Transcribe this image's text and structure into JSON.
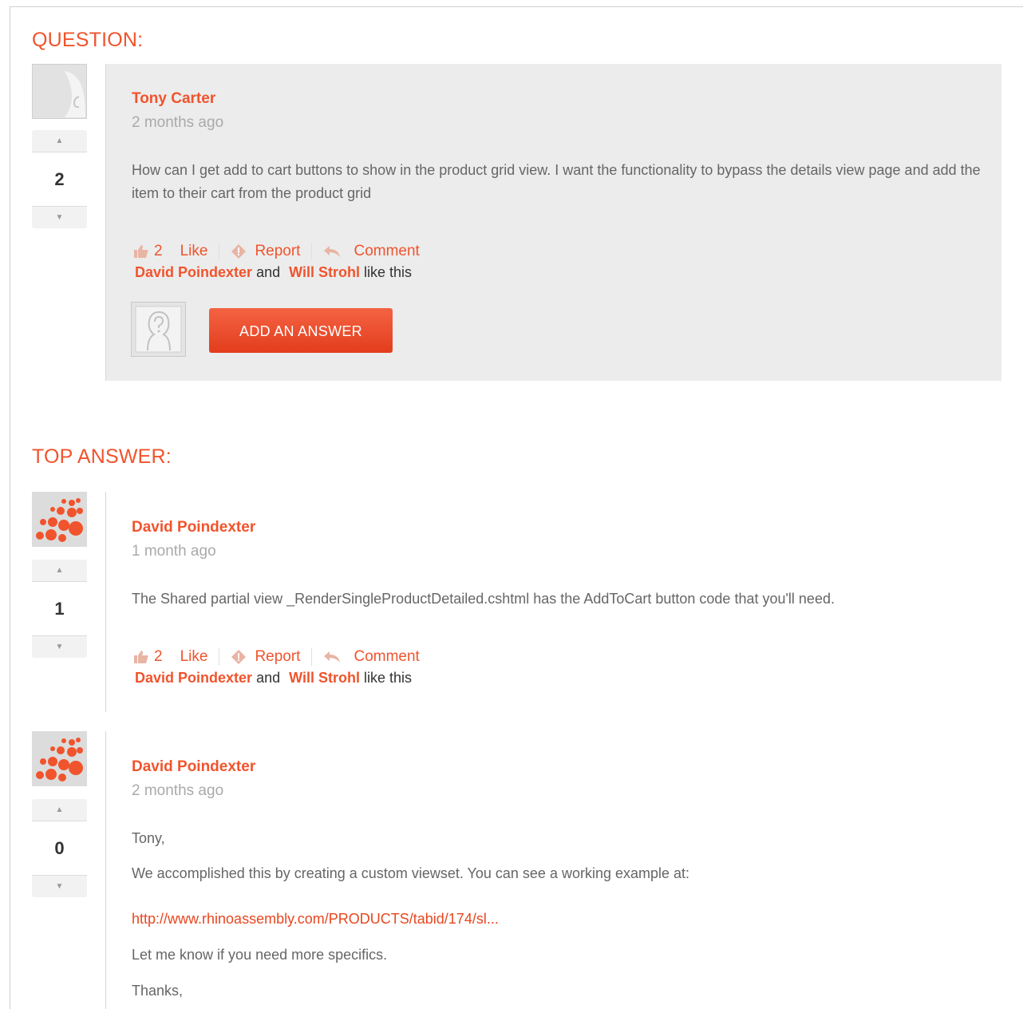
{
  "question": {
    "section_title": "QUESTION:",
    "author": "Tony Carter",
    "time": "2 months ago",
    "votes": "2",
    "body": "How can I get add to cart buttons to show in the product grid view. I want the functionality to bypass the details view page and add the item to their cart from the product grid",
    "like_count": "2",
    "like_label": "Like",
    "report_label": "Report",
    "comment_label": "Comment",
    "liker1": "David Poindexter",
    "and_text": "and",
    "liker2": "Will Strohl",
    "like_this": "like this",
    "add_answer_label": "ADD AN ANSWER"
  },
  "top_answer": {
    "section_title": "TOP ANSWER:",
    "author": "David Poindexter",
    "time": "1 month ago",
    "votes": "1",
    "body": "The Shared partial view _RenderSingleProductDetailed.cshtml has the AddToCart button code that you'll need.",
    "like_count": "2",
    "like_label": "Like",
    "report_label": "Report",
    "comment_label": "Comment",
    "liker1": "David Poindexter",
    "and_text": "and",
    "liker2": "Will Strohl",
    "like_this": "like this"
  },
  "answer2": {
    "author": "David Poindexter",
    "time": "2 months ago",
    "votes": "0",
    "line1": "Tony,",
    "line2": "We accomplished this by creating a custom viewset.  You can see a working example at:",
    "link": "http://www.rhinoassembly.com/PRODUCTS/tabid/174/sl...",
    "line3": "Let me know if you need more specifics.",
    "line4": "Thanks,"
  },
  "icons": {
    "vote_up": "▲",
    "vote_down": "▼"
  },
  "colors": {
    "accent": "#f0542d",
    "panel": "#ececec"
  }
}
